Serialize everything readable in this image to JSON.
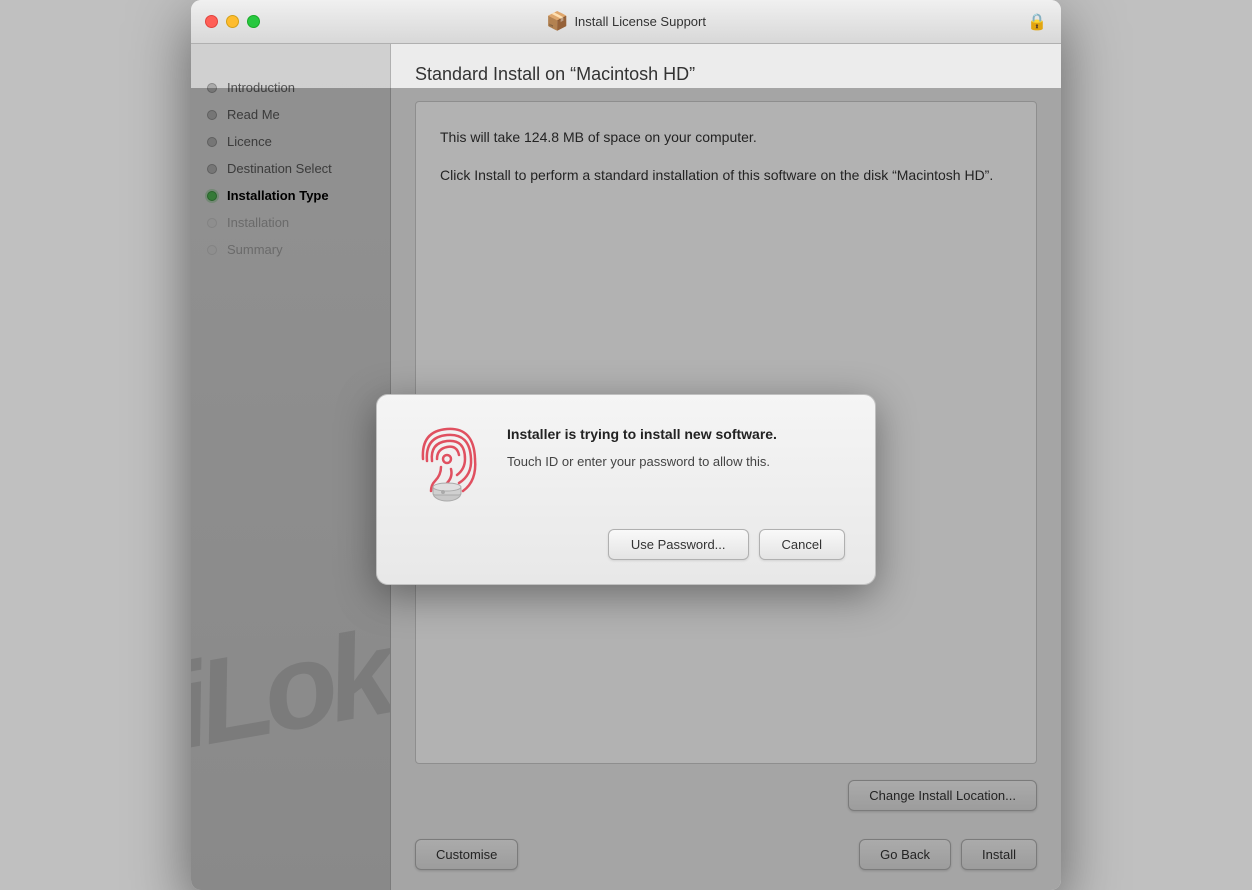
{
  "window": {
    "title": "Install License Support",
    "title_icon": "📦",
    "lock_icon": "🔒"
  },
  "traffic_lights": {
    "red_label": "close",
    "yellow_label": "minimize",
    "green_label": "maximize"
  },
  "sidebar": {
    "items": [
      {
        "id": "introduction",
        "label": "Introduction",
        "state": "done"
      },
      {
        "id": "read-me",
        "label": "Read Me",
        "state": "done"
      },
      {
        "id": "licence",
        "label": "Licence",
        "state": "done"
      },
      {
        "id": "destination-select",
        "label": "Destination Select",
        "state": "done"
      },
      {
        "id": "installation-type",
        "label": "Installation Type",
        "state": "active"
      },
      {
        "id": "installation",
        "label": "Installation",
        "state": "dimmed"
      },
      {
        "id": "summary",
        "label": "Summary",
        "state": "dimmed"
      }
    ],
    "ilok_text": "iLok"
  },
  "content": {
    "section_title": "Standard Install on “Macintosh HD”",
    "info_text_1": "This will take 124.8 MB of space on your computer.",
    "info_text_2": "Click Install to perform a standard installation of this software on the disk “Macintosh HD”.",
    "change_location_label": "Change Install Location...",
    "customise_label": "Customise",
    "go_back_label": "Go Back",
    "install_label": "Install"
  },
  "modal": {
    "title": "Installer is trying to install new software.",
    "description": "Touch ID or enter your password to allow this.",
    "use_password_label": "Use Password...",
    "cancel_label": "Cancel"
  }
}
